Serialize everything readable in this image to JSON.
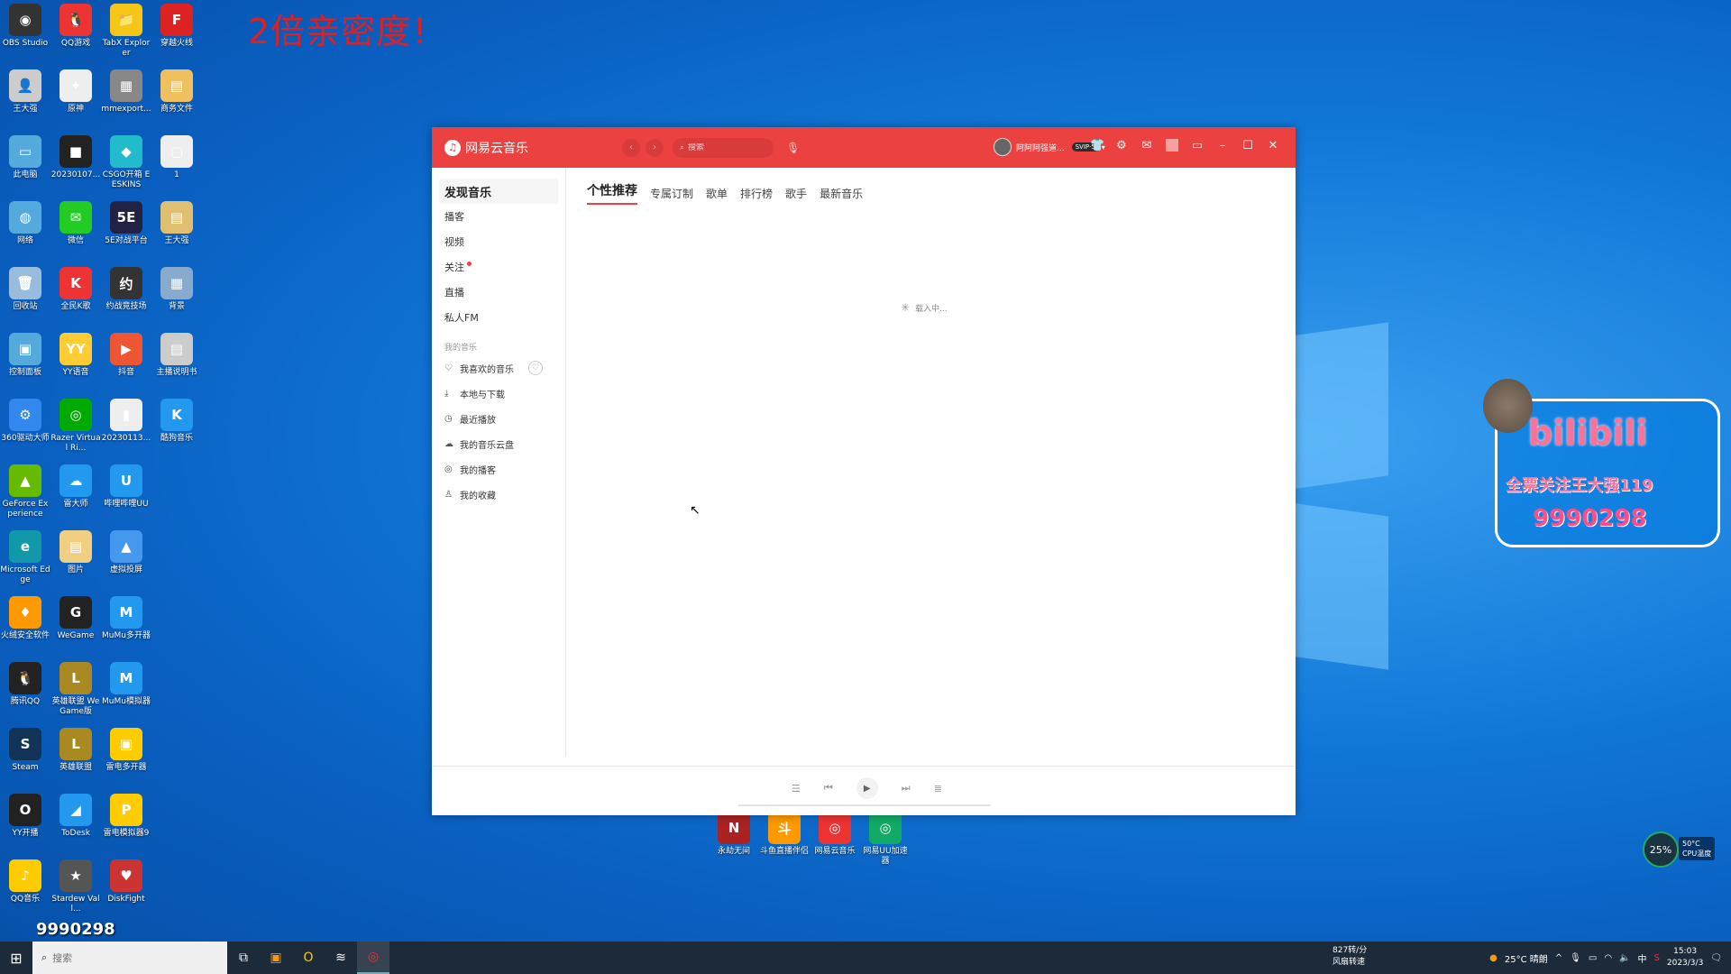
{
  "desktop": {
    "banner": "2倍亲密度！",
    "icons": [
      {
        "label": "OBS Studio",
        "glyph": "◉",
        "color": "#333"
      },
      {
        "label": "QQ游戏",
        "glyph": "🐧",
        "color": "#e33"
      },
      {
        "label": "TabX Explorer",
        "glyph": "📁",
        "color": "#f5c518"
      },
      {
        "label": "穿越火线",
        "glyph": "F",
        "color": "#d22"
      },
      {
        "label": "王大强",
        "glyph": "👤",
        "color": "#ccc"
      },
      {
        "label": "原神",
        "glyph": "✦",
        "color": "#eee"
      },
      {
        "label": "mmexport...",
        "glyph": "▦",
        "color": "#888"
      },
      {
        "label": "商务文件",
        "glyph": "▤",
        "color": "#f0c060"
      },
      {
        "label": "此电脑",
        "glyph": "▭",
        "color": "#5ad"
      },
      {
        "label": "20230107...",
        "glyph": "■",
        "color": "#222"
      },
      {
        "label": "CSGO开箱 EESKINS",
        "glyph": "◆",
        "color": "#2bc"
      },
      {
        "label": "1",
        "glyph": "▢",
        "color": "#eee"
      },
      {
        "label": "网络",
        "glyph": "◍",
        "color": "#5ad"
      },
      {
        "label": "微信",
        "glyph": "✉",
        "color": "#2c2"
      },
      {
        "label": "5E对战平台",
        "glyph": "5E",
        "color": "#224"
      },
      {
        "label": "王大强",
        "glyph": "▤",
        "color": "#e0c070"
      },
      {
        "label": "回收站",
        "glyph": "🗑",
        "color": "#9bd"
      },
      {
        "label": "全民K歌",
        "glyph": "K",
        "color": "#e33"
      },
      {
        "label": "约战竞技场",
        "glyph": "约",
        "color": "#333"
      },
      {
        "label": "背景",
        "glyph": "▦",
        "color": "#8ac"
      },
      {
        "label": "控制面板",
        "glyph": "▣",
        "color": "#5ad"
      },
      {
        "label": "YY语音",
        "glyph": "YY",
        "color": "#fc3"
      },
      {
        "label": "抖音",
        "glyph": "▶",
        "color": "#e53"
      },
      {
        "label": "主播说明书",
        "glyph": "▤",
        "color": "#ccc"
      },
      {
        "label": "360驱动大师",
        "glyph": "⚙",
        "color": "#38e"
      },
      {
        "label": "Razer Virtual Ri...",
        "glyph": "◎",
        "color": "#0a0"
      },
      {
        "label": "20230113...",
        "glyph": "▮",
        "color": "#eee"
      },
      {
        "label": "酷狗音乐",
        "glyph": "K",
        "color": "#29e"
      },
      {
        "label": "GeForce Experience",
        "glyph": "▲",
        "color": "#6b0"
      },
      {
        "label": "雷大师",
        "glyph": "☁",
        "color": "#29e"
      },
      {
        "label": "哔哩哔哩UU",
        "glyph": "U",
        "color": "#29e"
      },
      {
        "label": "",
        "glyph": "",
        "color": "transparent"
      },
      {
        "label": "Microsoft Edge",
        "glyph": "e",
        "color": "#19a"
      },
      {
        "label": "图片",
        "glyph": "▤",
        "color": "#f0d080"
      },
      {
        "label": "虚拟投屏",
        "glyph": "▲",
        "color": "#49e"
      },
      {
        "label": "",
        "glyph": "",
        "color": "transparent"
      },
      {
        "label": "火绒安全软件",
        "glyph": "♦",
        "color": "#f90"
      },
      {
        "label": "WeGame",
        "glyph": "G",
        "color": "#222"
      },
      {
        "label": "MuMu多开器",
        "glyph": "M",
        "color": "#29e"
      },
      {
        "label": "",
        "glyph": "",
        "color": "transparent"
      },
      {
        "label": "腾讯QQ",
        "glyph": "🐧",
        "color": "#222"
      },
      {
        "label": "英雄联盟 WeGame版",
        "glyph": "L",
        "color": "#a82"
      },
      {
        "label": "MuMu模拟器",
        "glyph": "M",
        "color": "#29e"
      },
      {
        "label": "",
        "glyph": "",
        "color": "transparent"
      },
      {
        "label": "Steam",
        "glyph": "S",
        "color": "#135"
      },
      {
        "label": "英雄联盟",
        "glyph": "L",
        "color": "#a82"
      },
      {
        "label": "雷电多开器",
        "glyph": "▣",
        "color": "#fc0"
      },
      {
        "label": "",
        "glyph": "",
        "color": "transparent"
      },
      {
        "label": "YY开播",
        "glyph": "O",
        "color": "#222"
      },
      {
        "label": "ToDesk",
        "glyph": "◢",
        "color": "#29e"
      },
      {
        "label": "雷电模拟器9",
        "glyph": "P",
        "color": "#fc0"
      },
      {
        "label": "",
        "glyph": "",
        "color": "transparent"
      },
      {
        "label": "QQ音乐",
        "glyph": "♪",
        "color": "#fc0"
      },
      {
        "label": "Stardew Vall...",
        "glyph": "★",
        "color": "#555"
      },
      {
        "label": "DiskFight",
        "glyph": "♥",
        "color": "#c33"
      }
    ],
    "loose_icons": [
      {
        "label": "永劫无间",
        "glyph": "N",
        "color": "#a22"
      },
      {
        "label": "斗鱼直播伴侣",
        "glyph": "斗",
        "color": "#f90"
      },
      {
        "label": "网易云音乐",
        "glyph": "◎",
        "color": "#e33"
      },
      {
        "label": "网易UU加速器",
        "glyph": "◎",
        "color": "#1a6"
      }
    ],
    "watermark_num": "9990298",
    "bili": {
      "logo": "bilibili",
      "line": "全票关注王大强119",
      "num": "9990298"
    },
    "cpu": {
      "pct": "25%",
      "temp": "50°C",
      "label": "CPU温度"
    }
  },
  "app": {
    "name": "网易云音乐",
    "search_placeholder": "搜索",
    "username": "阿阿阿强道...",
    "vip_label": "SVIP·5",
    "sidebar": {
      "items": [
        {
          "label": "发现音乐",
          "active": true
        },
        {
          "label": "播客"
        },
        {
          "label": "视频"
        },
        {
          "label": "关注",
          "dot": true
        },
        {
          "label": "直播"
        },
        {
          "label": "私人FM"
        }
      ],
      "section": "我的音乐",
      "my_music": [
        {
          "label": "我喜欢的音乐",
          "icon": "heart"
        },
        {
          "label": "本地与下载",
          "icon": "download"
        },
        {
          "label": "最近播放",
          "icon": "clock"
        },
        {
          "label": "我的音乐云盘",
          "icon": "cloud"
        },
        {
          "label": "我的播客",
          "icon": "radio"
        },
        {
          "label": "我的收藏",
          "icon": "star"
        }
      ]
    },
    "tabs": [
      "个性推荐",
      "专属订制",
      "歌单",
      "排行榜",
      "歌手",
      "最新音乐"
    ],
    "loading_text": "载入中...",
    "progress": 0
  },
  "taskbar": {
    "search_placeholder": "搜索",
    "net_speed": "827转/分",
    "net_label": "风扇转速",
    "weather": "25°C 晴朗",
    "ime": "中",
    "time": "15:03",
    "date": "2023/3/3"
  }
}
